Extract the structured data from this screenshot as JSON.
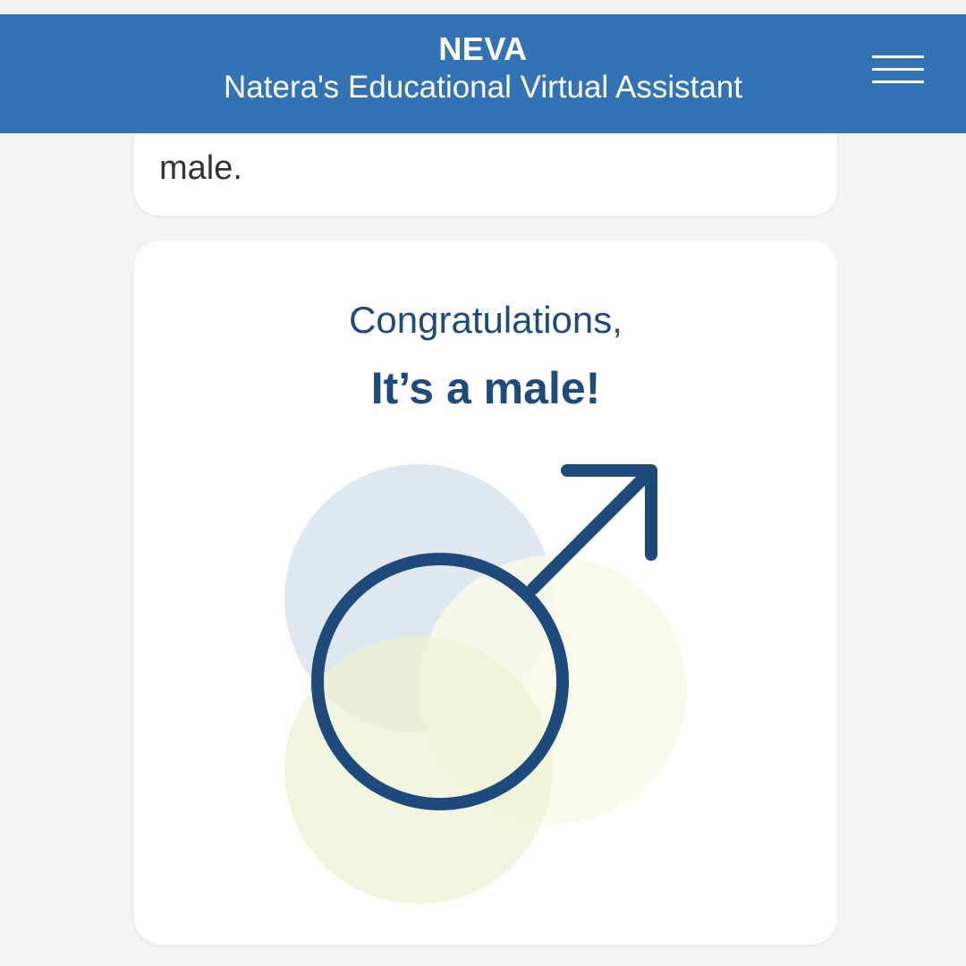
{
  "header": {
    "title": "NEVA",
    "subtitle": "Natera's Educational Virtual Assistant",
    "menu_icon": "hamburger-menu-icon",
    "background_color": "#3372b4"
  },
  "chat": {
    "previous_message_tail": "male.",
    "result_card": {
      "greeting": "Congratulations,",
      "headline": "It’s a male!",
      "symbol_icon": "male-symbol-icon",
      "symbol_color": "#1f4a7c",
      "circle_colors": [
        "#dfe8f1",
        "#f6f6df",
        "#f2f5dc"
      ]
    }
  }
}
